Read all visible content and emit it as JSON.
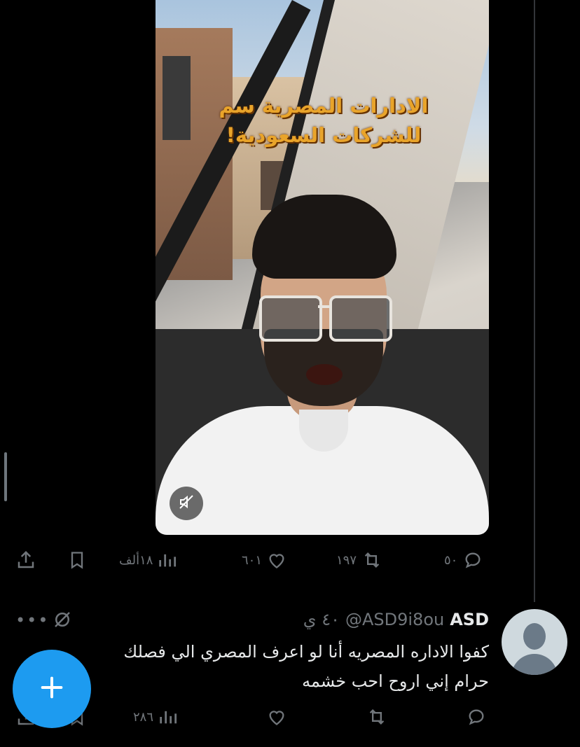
{
  "tweet": {
    "media": {
      "overlay_text": "الادارات المصرية سم للشركات السعودية!",
      "mute_icon": "speaker-muted-icon"
    },
    "actions": {
      "replies": "٥٠",
      "reposts": "١٩٧",
      "likes": "٦٠١",
      "views": "١٨ألف"
    }
  },
  "reply": {
    "name": "ASD",
    "handle": "@ASD9i8ou",
    "time": "٤٠ ي",
    "text_line1": "كفوا الاداره المصريه أنا لو اعرف المصري الي فصلك",
    "text_line2": "حرام إني اروح احب خشمه",
    "actions": {
      "views": "٢٨٦"
    }
  },
  "fab": {
    "icon": "plus-icon"
  },
  "colors": {
    "accent": "#1d9bf0",
    "muted": "#71767b",
    "background": "#000000"
  }
}
